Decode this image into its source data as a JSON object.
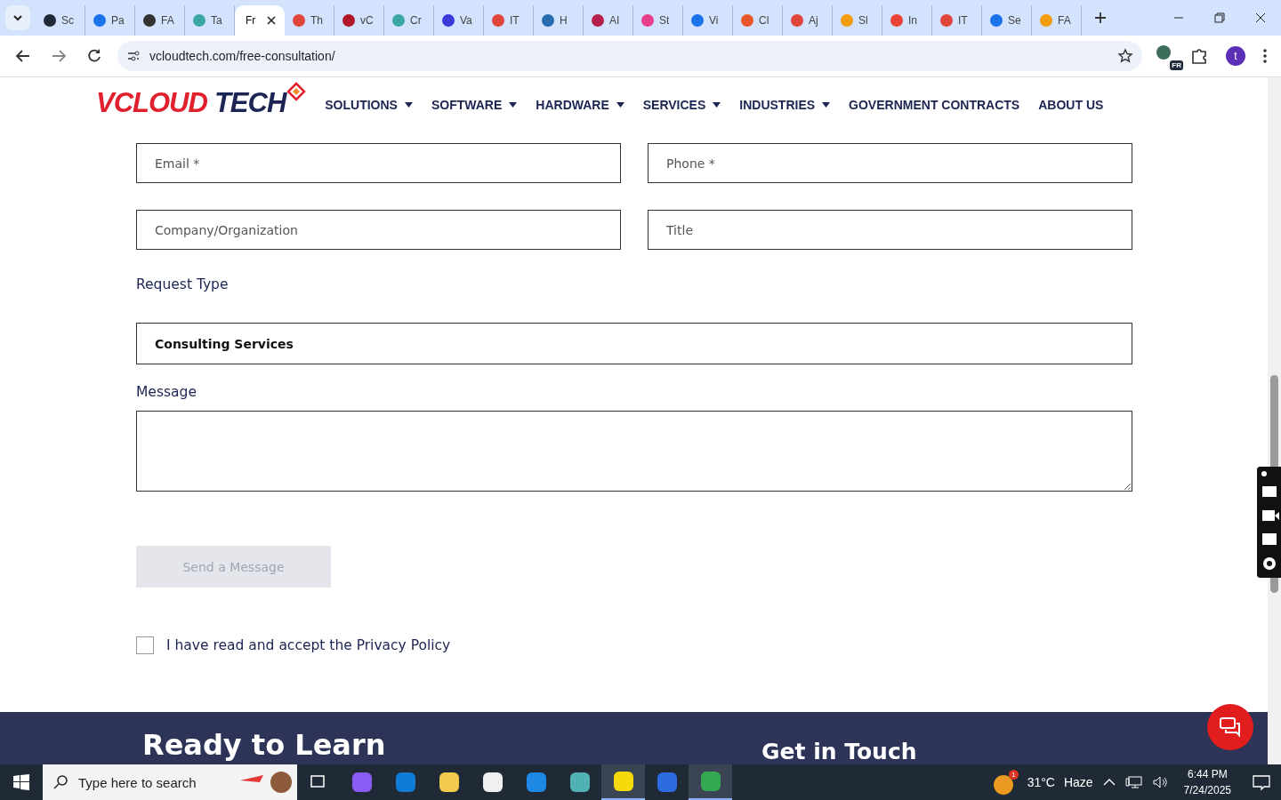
{
  "browser": {
    "tabs": [
      {
        "title": "Sc",
        "color": "#1f2937",
        "selected": false
      },
      {
        "title": "Pa",
        "color": "#1a73e8",
        "selected": false
      },
      {
        "title": "FA",
        "color": "#333333",
        "selected": false
      },
      {
        "title": "Ta",
        "color": "#3aa6a6",
        "selected": false
      },
      {
        "title": "Fr",
        "selected": true
      },
      {
        "title": "Th",
        "color": "#e0453a",
        "selected": false
      },
      {
        "title": "vC",
        "color": "#b0172a",
        "selected": false
      },
      {
        "title": "Cr",
        "color": "#3aa6a6",
        "selected": false
      },
      {
        "title": "Va",
        "color": "#3b3bdc",
        "selected": false
      },
      {
        "title": "IT",
        "color": "#e0453a",
        "selected": false
      },
      {
        "title": "H",
        "color": "#2a6cb0",
        "selected": false
      },
      {
        "title": "AI",
        "color": "#b4204a",
        "selected": false
      },
      {
        "title": "St",
        "color": "#e83e8c",
        "selected": false
      },
      {
        "title": "Vi",
        "color": "#1a73e8",
        "selected": false
      },
      {
        "title": "Cl",
        "color": "#e8562a",
        "selected": false
      },
      {
        "title": "Aj",
        "color": "#e0453a",
        "selected": false
      },
      {
        "title": "Sl",
        "color": "#f39c12",
        "selected": false
      },
      {
        "title": "In",
        "color": "#ea4335",
        "selected": false
      },
      {
        "title": "IT",
        "color": "#e0453a",
        "selected": false
      },
      {
        "title": "Se",
        "color": "#1a73e8",
        "selected": false
      },
      {
        "title": "FA",
        "color": "#f39c12",
        "selected": false
      }
    ],
    "url": "vcloudtech.com/free-consultation/",
    "translate_badge": "FR",
    "profile_initial": "t"
  },
  "site": {
    "logo": {
      "brand": "VCLOUD",
      "suffix": "TECH"
    },
    "nav": [
      {
        "label": "SOLUTIONS",
        "has_menu": true
      },
      {
        "label": "SOFTWARE",
        "has_menu": true
      },
      {
        "label": "HARDWARE",
        "has_menu": true
      },
      {
        "label": "SERVICES",
        "has_menu": true
      },
      {
        "label": "INDUSTRIES",
        "has_menu": true
      },
      {
        "label": "GOVERNMENT CONTRACTS",
        "has_menu": false
      },
      {
        "label": "ABOUT US",
        "has_menu": false
      }
    ],
    "form": {
      "fields": [
        {
          "placeholder": "Email *"
        },
        {
          "placeholder": "Phone *"
        },
        {
          "placeholder": "Company/Organization"
        },
        {
          "placeholder": "Title"
        }
      ],
      "request_label": "Request Type",
      "request_value": "Consulting Services",
      "message_label": "Message",
      "submit": {
        "label": "Send a Message",
        "disabled": true
      },
      "consent": {
        "label": "I have read and accept the Privacy Policy",
        "checked": false
      }
    },
    "footer": {
      "heading": "Ready to Learn",
      "contact_heading": "Get in Touch"
    }
  },
  "taskbar": {
    "search_placeholder": "Type here to search",
    "apps": [
      {
        "color": "#8a5cf6",
        "active": false
      },
      {
        "color": "#0f7bd8",
        "active": false
      },
      {
        "color": "#f2c94c",
        "active": false
      },
      {
        "color": "#f0f0f0",
        "active": false
      },
      {
        "color": "#1e88e5",
        "active": false
      },
      {
        "color": "#4fb3b3",
        "active": false
      },
      {
        "color": "#f5d90a",
        "active": true
      },
      {
        "color": "#2d6cdf",
        "active": false
      },
      {
        "color": "#34a853",
        "active": true
      }
    ],
    "weather_badge": "1",
    "temperature": "31°C",
    "weather": "Haze",
    "time": "6:44 PM",
    "date": "7/24/2025"
  }
}
